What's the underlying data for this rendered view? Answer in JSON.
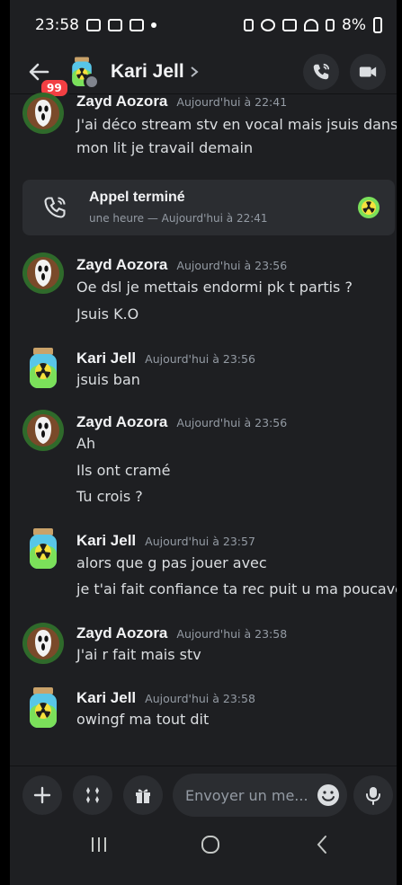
{
  "status": {
    "time": "23:58",
    "battery": "8%"
  },
  "header": {
    "unread_badge": "99",
    "name": "Kari Jell"
  },
  "messages": [
    {
      "author": "Zayd Aozora",
      "time": "Aujourd'hui à 22:41",
      "lines": [
        "J'ai déco stream stv en vocal mais jsuis dans",
        "mon lit je travail demain"
      ]
    },
    {
      "author": "Zayd Aozora",
      "time": "Aujourd'hui à 23:56",
      "lines": [
        "Oe dsl je mettais endormi pk t partis ?",
        "Jsuis K.O"
      ]
    },
    {
      "author": "Kari Jell",
      "time": "Aujourd'hui à 23:56",
      "lines": [
        "jsuis ban"
      ]
    },
    {
      "author": "Zayd Aozora",
      "time": "Aujourd'hui à 23:56",
      "lines": [
        "Ah",
        "Ils ont cramé",
        "Tu crois ?"
      ]
    },
    {
      "author": "Kari Jell",
      "time": "Aujourd'hui à 23:57",
      "lines": [
        "alors que g pas jouer avec",
        "je t'ai fait confiance ta rec puit u ma poucave"
      ]
    },
    {
      "author": "Zayd Aozora",
      "time": "Aujourd'hui à 23:58",
      "lines": [
        "J'ai r fait mais stv"
      ]
    },
    {
      "author": "Kari Jell",
      "time": "Aujourd'hui à 23:58",
      "lines": [
        "owingf ma tout dit"
      ]
    }
  ],
  "call": {
    "title": "Appel terminé",
    "subtitle": "une heure — Aujourd'hui à 22:41"
  },
  "composer": {
    "placeholder": "Envoyer un me..."
  },
  "icons": [
    "back-arrow-icon",
    "phone-icon",
    "video-icon",
    "plus-icon",
    "apps-icon",
    "gift-icon",
    "emoji-icon",
    "mic-icon",
    "nav-recents-icon",
    "nav-home-icon",
    "nav-back-icon"
  ],
  "colors": {
    "background": "#1e1f22",
    "card": "#2b2d31",
    "badge": "#f23f43"
  }
}
